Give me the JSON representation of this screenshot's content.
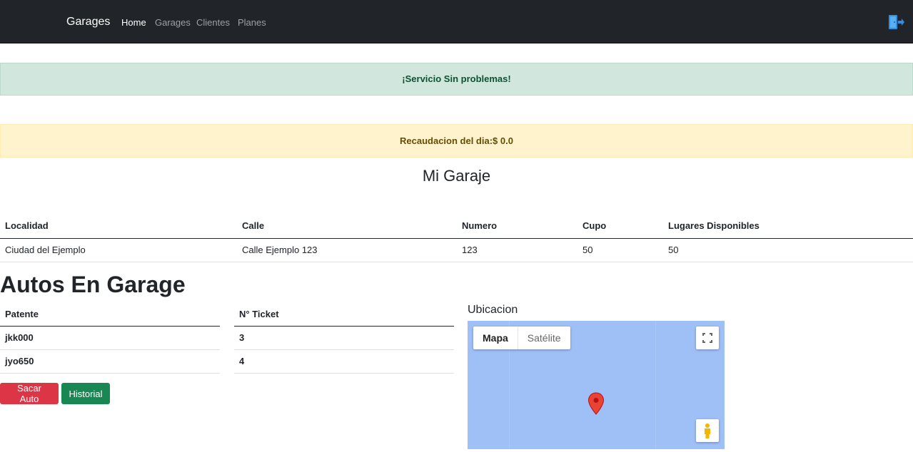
{
  "navbar": {
    "brand": "Garages",
    "links": [
      "Home",
      "Garages",
      "Clientes",
      "Planes"
    ],
    "logout_icon": "logout-icon"
  },
  "alerts": {
    "success": "¡Servicio Sin problemas!",
    "warning": "Recaudacion del dia:$ 0.0"
  },
  "garage": {
    "title": "Mi Garaje",
    "headers": [
      "Localidad",
      "Calle",
      "Numero",
      "Cupo",
      "Lugares Disponibles"
    ],
    "row": [
      "Ciudad del Ejemplo",
      "Calle Ejemplo 123",
      "123",
      "50",
      "50"
    ]
  },
  "autos": {
    "title": "Autos En Garage",
    "patente_header": "Patente",
    "ticket_header": "N° Ticket",
    "patentes": [
      "jkk000",
      "jyo650"
    ],
    "tickets": [
      "3",
      "4"
    ],
    "sacar_button": "Sacar Auto",
    "historial_button": "Historial"
  },
  "map": {
    "label": "Ubicacion",
    "type_map": "Mapa",
    "type_satellite": "Satélite",
    "water_color": "#9fbff7",
    "marker_color": "#ea4335"
  }
}
